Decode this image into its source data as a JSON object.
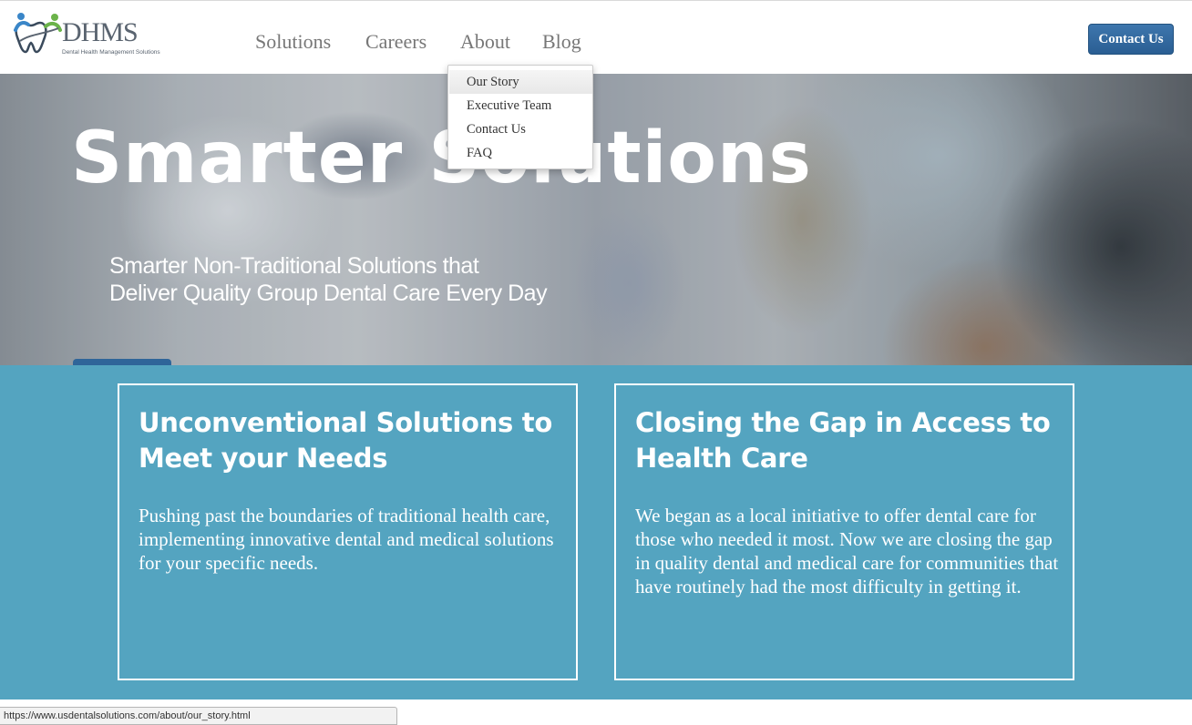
{
  "header": {
    "logo": {
      "text": "DHMS",
      "subtitle": "Dental Health Management Solutions"
    },
    "nav": [
      {
        "label": "Solutions"
      },
      {
        "label": "Careers"
      },
      {
        "label": "About"
      },
      {
        "label": "Blog"
      }
    ],
    "contact_button": "Contact Us"
  },
  "dropdown": {
    "items": [
      {
        "label": "Our Story",
        "hovered": true
      },
      {
        "label": "Executive Team"
      },
      {
        "label": "Contact Us"
      },
      {
        "label": "FAQ"
      }
    ]
  },
  "hero": {
    "title": "Smarter Solutions",
    "subtitle_line1": "Smarter Non-Traditional Solutions that",
    "subtitle_line2": "Deliver Quality Group Dental Care Every Day"
  },
  "cards": [
    {
      "title": "Unconventional Solutions to Meet your Needs",
      "body": "Pushing past the boundaries of traditional health care, implementing innovative dental and medical solutions for your specific needs."
    },
    {
      "title": "Closing the Gap in Access to Health Care",
      "body": "We began as a local initiative to offer dental care for those who needed it most. Now we are closing the gap in quality dental and medical care for communities that have routinely had the most difficulty in getting it."
    }
  ],
  "status_bar": {
    "url": "https://www.usdentalsolutions.com/about/our_story.html"
  },
  "colors": {
    "accent_blue": "#2a5e93",
    "section_teal": "#54a4c0",
    "nav_gray": "#777777"
  },
  "icons": {
    "logo_mark": "tooth-people-logo-icon"
  }
}
